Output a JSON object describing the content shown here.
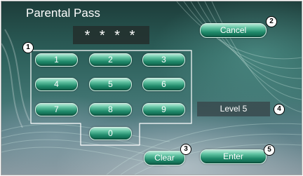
{
  "screen": {
    "title": "Parental Pass",
    "pin_display": "* * * *"
  },
  "keypad": {
    "keys": [
      "1",
      "2",
      "3",
      "4",
      "5",
      "6",
      "7",
      "8",
      "9",
      "0"
    ]
  },
  "actions": {
    "cancel_label": "Cancel",
    "clear_label": "Clear",
    "enter_label": "Enter"
  },
  "status": {
    "level": "Level 5"
  },
  "callouts": [
    "1",
    "2",
    "3",
    "4",
    "5"
  ],
  "colors": {
    "button_green": "#1e8869",
    "callout_fill": "#ffffff"
  }
}
